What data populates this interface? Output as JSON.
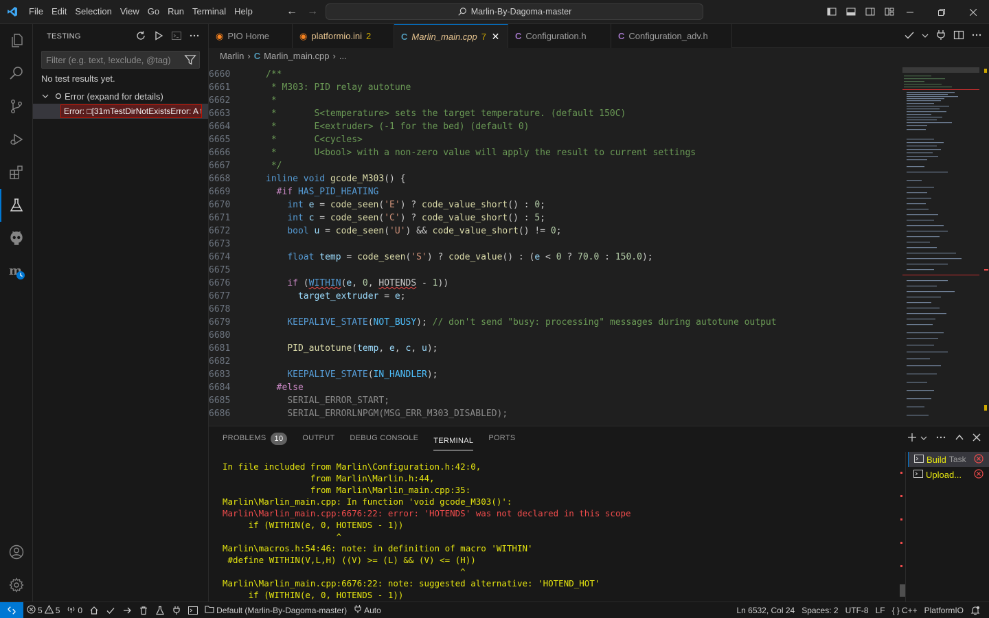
{
  "menu": [
    "File",
    "Edit",
    "Selection",
    "View",
    "Go",
    "Run",
    "Terminal",
    "Help"
  ],
  "command_center": "Marlin-By-Dagoma-master",
  "sidebar": {
    "title": "TESTING",
    "filter_placeholder": "Filter (e.g. text, !exclude, @tag)",
    "no_results": "No test results yet.",
    "error_node": "Error (expand for details)",
    "error_message": "Error: □[31mTestDirNotExistsError: A t"
  },
  "tabs": [
    {
      "label": "PIO Home",
      "icon": "pio-icon"
    },
    {
      "label": "platformio.ini",
      "badge": "2",
      "icon": "pio-icon"
    },
    {
      "label": "Marlin_main.cpp",
      "badge": "7",
      "icon": "cpp-icon"
    },
    {
      "label": "Configuration.h",
      "icon": "c-icon"
    },
    {
      "label": "Configuration_adv.h",
      "icon": "c-icon"
    }
  ],
  "breadcrumb": {
    "folder": "Marlin",
    "file": "Marlin_main.cpp",
    "more": "..."
  },
  "editor": {
    "line_numbers": [
      "6660",
      "6661",
      "6662",
      "6663",
      "6664",
      "6665",
      "6666",
      "6667",
      "6668",
      "6669",
      "6670",
      "6671",
      "6672",
      "6673",
      "6674",
      "6675",
      "6676",
      "6677",
      "6678",
      "6679",
      "6680",
      "6681",
      "6682",
      "6683",
      "6684",
      "6685",
      "6686"
    ]
  },
  "panel": {
    "tabs": [
      "PROBLEMS",
      "OUTPUT",
      "DEBUG CONSOLE",
      "TERMINAL",
      "PORTS"
    ],
    "problems_count": "10",
    "terminal_lines": [
      "In file included from Marlin\\Configuration.h:42:0,",
      "                 from Marlin\\Marlin.h:44,",
      "                 from Marlin\\Marlin_main.cpp:35:",
      "Marlin\\Marlin_main.cpp: In function 'void gcode_M303()':",
      "Marlin\\Marlin_main.cpp:6676:22: error: 'HOTENDS' was not declared in this scope",
      "     if (WITHIN(e, 0, HOTENDS - 1))",
      "                      ^",
      "Marlin\\macros.h:54:46: note: in definition of macro 'WITHIN'",
      " #define WITHIN(V,L,H) ((V) >= (L) && (V) <= (H))",
      "                                              ^",
      "Marlin\\Marlin_main.cpp:6676:22: note: suggested alternative: 'HOTEND_HOT'",
      "     if (WITHIN(e, 0, HOTENDS - 1))"
    ],
    "terminals": [
      {
        "name": "Build",
        "task": "Task"
      },
      {
        "name": "Upload..."
      }
    ]
  },
  "status": {
    "errors": "5",
    "warnings": "5",
    "ports": "0",
    "env": "Default (Marlin-By-Dagoma-master)",
    "auto": "Auto",
    "position": "Ln 6532, Col 24",
    "spaces": "Spaces: 2",
    "encoding": "UTF-8",
    "eol": "LF",
    "language": "C++",
    "platformio": "PlatformIO"
  },
  "colors": {
    "accent": "#0078d4",
    "error": "#f14c4c",
    "warning": "#cca700",
    "terminal_yellow": "#e5e510"
  }
}
